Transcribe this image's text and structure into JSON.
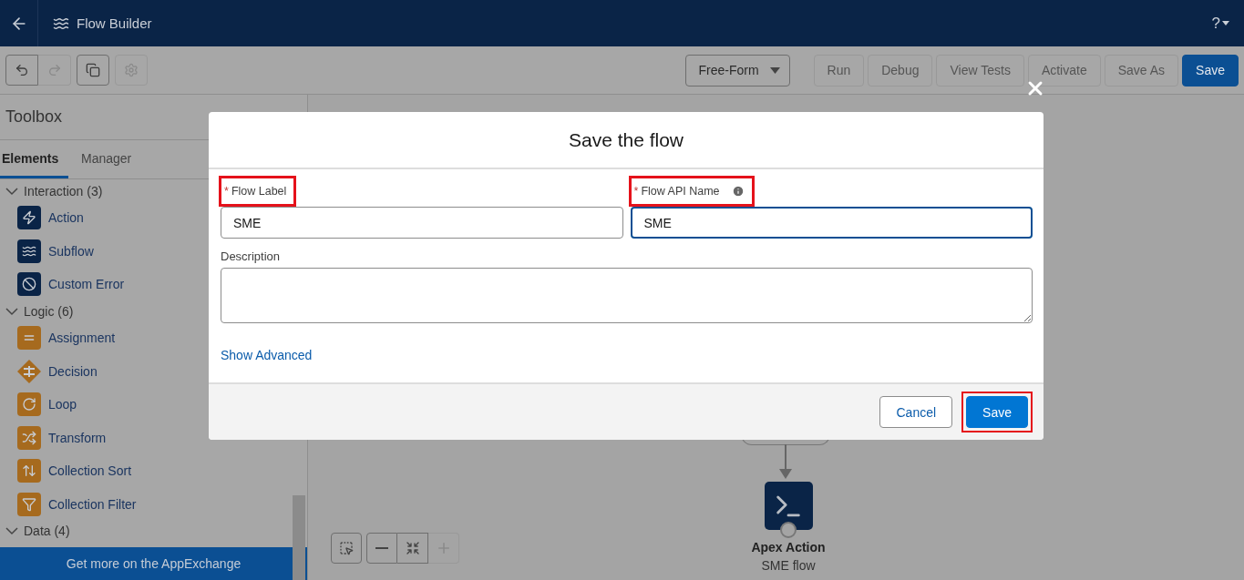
{
  "header": {
    "title": "Flow Builder",
    "help_label": "?"
  },
  "toolbar": {
    "icon_buttons": [
      {
        "kind": "undo",
        "disabled": false
      },
      {
        "kind": "redo",
        "disabled": true
      },
      {
        "kind": "copy",
        "disabled": false
      },
      {
        "kind": "settings",
        "disabled": true
      }
    ],
    "mode": "Free-Form",
    "buttons": [
      {
        "label": "Run",
        "disabled": true,
        "kind": "neutral"
      },
      {
        "label": "Debug",
        "disabled": true,
        "kind": "neutral"
      },
      {
        "label": "View Tests",
        "disabled": true,
        "kind": "neutral"
      },
      {
        "label": "Activate",
        "disabled": true,
        "kind": "neutral"
      },
      {
        "label": "Save As",
        "disabled": true,
        "kind": "neutral"
      },
      {
        "label": "Save",
        "disabled": false,
        "kind": "brand"
      }
    ]
  },
  "toolbox": {
    "title": "Toolbox",
    "tabs": [
      {
        "label": "Elements",
        "selected": true
      },
      {
        "label": "Manager",
        "selected": false
      }
    ],
    "sections": [
      {
        "label": "Interaction (3)",
        "expanded": true,
        "items": [
          {
            "label": "Action",
            "kind": "action"
          },
          {
            "label": "Subflow",
            "kind": "subflow"
          },
          {
            "label": "Custom Error",
            "kind": "error"
          }
        ]
      },
      {
        "label": "Logic (6)",
        "expanded": true,
        "items": [
          {
            "label": "Assignment",
            "kind": "assignment"
          },
          {
            "label": "Decision",
            "kind": "decision"
          },
          {
            "label": "Loop",
            "kind": "loop"
          },
          {
            "label": "Transform",
            "kind": "transform"
          },
          {
            "label": "Collection Sort",
            "kind": "sort"
          },
          {
            "label": "Collection Filter",
            "kind": "filter"
          }
        ]
      },
      {
        "label": "Data (4)",
        "expanded": true
      }
    ],
    "footer_link": "Get more on the AppExchange"
  },
  "canvas": {
    "node": {
      "kind": "apex_action",
      "type_label": "Apex Action",
      "name": "SME flow"
    }
  },
  "modal": {
    "title": "Save the flow",
    "fields": [
      {
        "label": "Flow Label",
        "required_mark": "*",
        "value": "SME",
        "focused": false,
        "highlighted": true,
        "info": false
      },
      {
        "label": "Flow API Name",
        "required_mark": "*",
        "value": "SME",
        "focused": true,
        "highlighted": true,
        "info": true
      }
    ],
    "description": {
      "label": "Description"
    },
    "advanced_link": "Show Advanced",
    "buttons": [
      {
        "label": "Cancel",
        "kind": "neutral",
        "highlighted": false
      },
      {
        "label": "Save",
        "kind": "brand",
        "highlighted": true
      }
    ]
  }
}
